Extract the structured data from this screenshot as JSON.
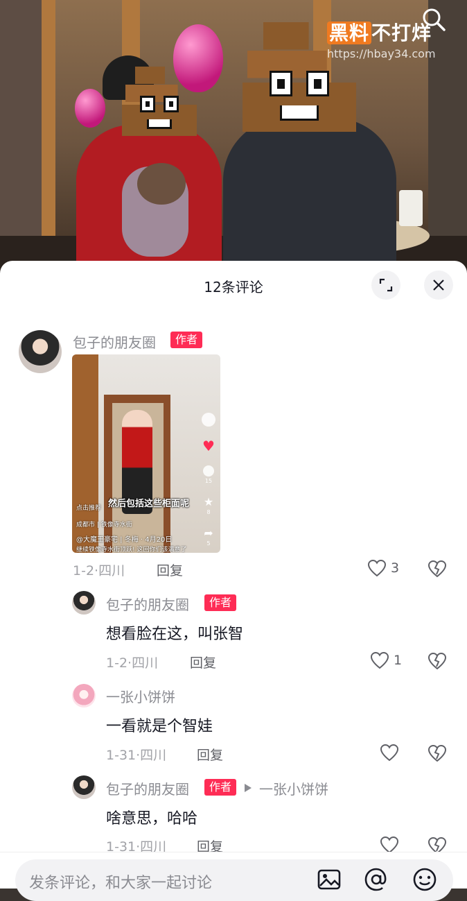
{
  "watermark": {
    "brand_boxed": "黑料",
    "brand_rest": "不打烊",
    "url": "https://hbay34.com"
  },
  "sheet": {
    "title": "12条评论"
  },
  "comments": [
    {
      "author": "包子的朋友圈",
      "badge": "作者",
      "image": {
        "caption": "然后包括这些柜面呢",
        "location": "成都市 | 铁像寺水街",
        "account": "@大魔王豪宅 | 冬梅 · 4月20日",
        "desc": "继续铁像寺水街顶跃! 这回你们该满意了",
        "recommend": "点击推荐",
        "counts": [
          "",
          "15",
          "8",
          "5"
        ]
      },
      "date": "1-2·四川",
      "reply": "回复",
      "likes": "3"
    },
    {
      "author": "包子的朋友圈",
      "badge": "作者",
      "text": "想看脸在这，叫张智",
      "date": "1-2·四川",
      "reply": "回复",
      "likes": "1"
    },
    {
      "author": "一张小饼饼",
      "text": "一看就是个智娃",
      "date": "1-31·四川",
      "reply": "回复",
      "likes": ""
    },
    {
      "author": "包子的朋友圈",
      "badge": "作者",
      "reply_to": "一张小饼饼",
      "text": "啥意思，哈哈",
      "date": "1-31·四川",
      "reply": "回复",
      "likes": ""
    }
  ],
  "input": {
    "placeholder": "发条评论，和大家一起讨论"
  },
  "colors": {
    "badge": "#fe2c55",
    "text": "#161823",
    "muted": "#8a8b91"
  }
}
